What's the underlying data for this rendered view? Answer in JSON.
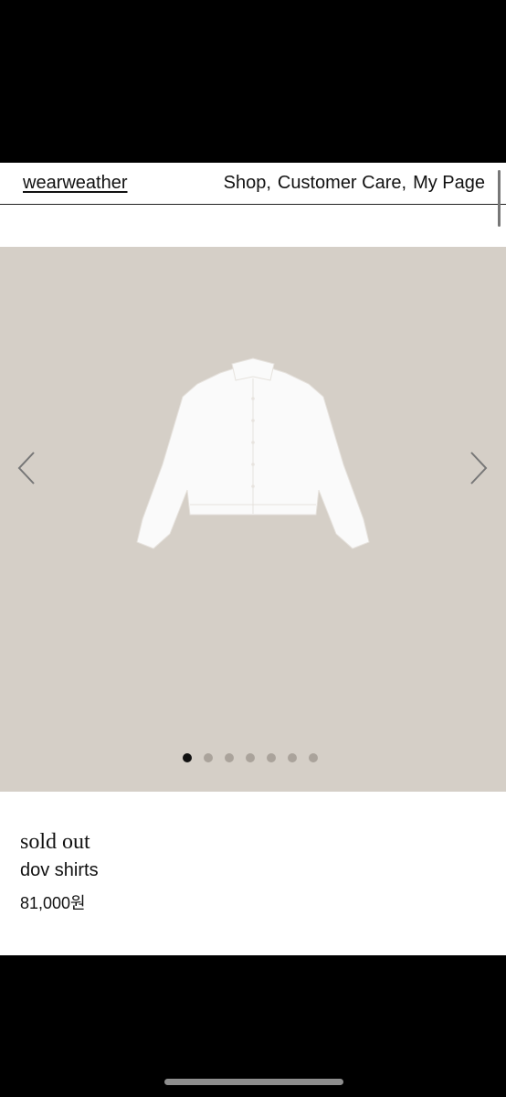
{
  "header": {
    "brand": "wearweather",
    "nav": [
      "Shop,",
      "Customer Care,",
      "My Page"
    ]
  },
  "gallery": {
    "image_label": "white cropped shirt",
    "slide_count": 7,
    "active_slide": 1
  },
  "product": {
    "status": "sold out",
    "name": "dov shirts",
    "price": "81,000원"
  },
  "colors": {
    "gallery_bg": "#d5cfc7",
    "text": "#111111",
    "dot_inactive": "#aaa39b",
    "dot_active": "#111111"
  }
}
